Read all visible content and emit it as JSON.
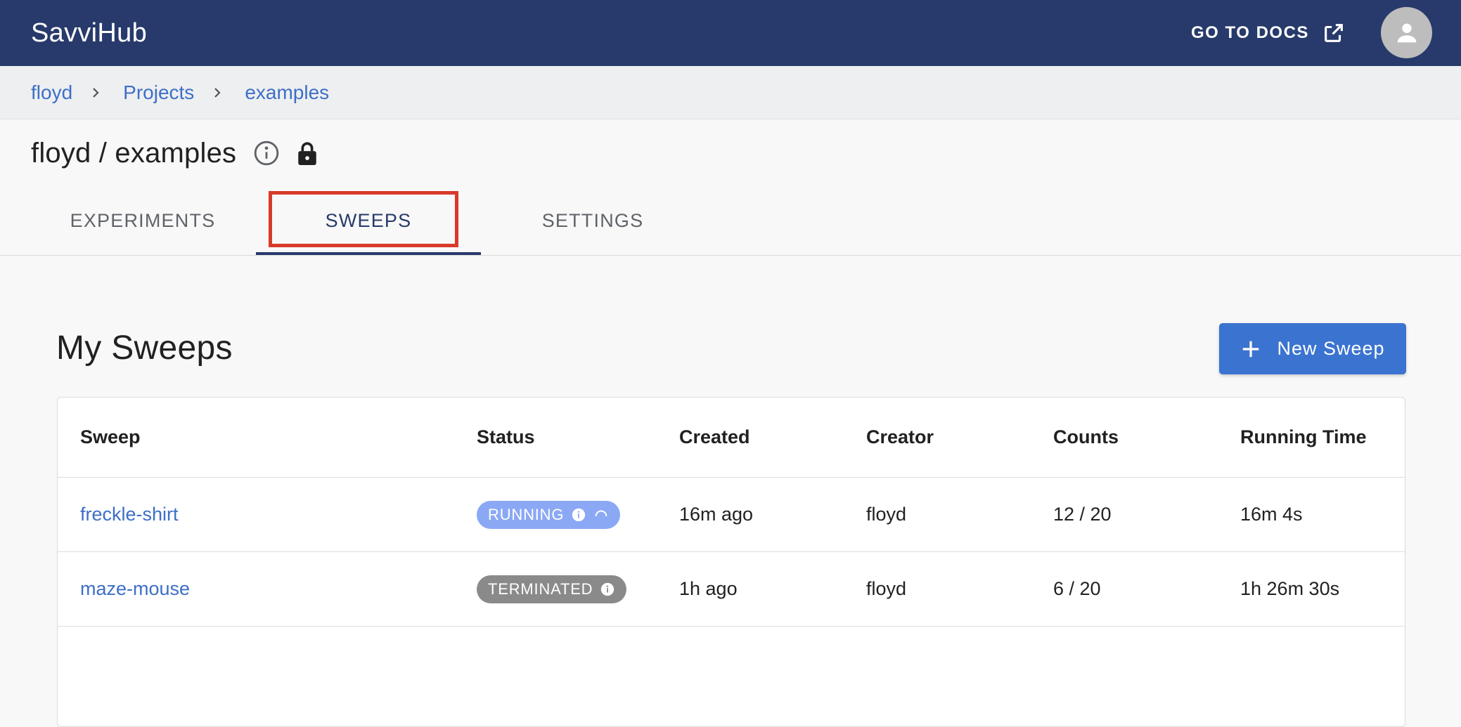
{
  "app": {
    "brand": "SavviHub",
    "docs_label": "GO TO DOCS"
  },
  "breadcrumb": [
    "floyd",
    "Projects",
    "examples"
  ],
  "page": {
    "title": "floyd / examples"
  },
  "tabs": [
    {
      "label": "EXPERIMENTS",
      "active": false
    },
    {
      "label": "SWEEPS",
      "active": true
    },
    {
      "label": "SETTINGS",
      "active": false
    }
  ],
  "sweeps": {
    "title": "My Sweeps",
    "new_button": "New Sweep",
    "columns": [
      "Sweep",
      "Status",
      "Created",
      "Creator",
      "Counts",
      "Running Time"
    ],
    "rows": [
      {
        "name": "freckle-shirt",
        "status": "RUNNING",
        "created": "16m ago",
        "creator": "floyd",
        "counts": "12 / 20",
        "running_time": "16m 4s"
      },
      {
        "name": "maze-mouse",
        "status": "TERMINATED",
        "created": "1h ago",
        "creator": "floyd",
        "counts": "6 / 20",
        "running_time": "1h 26m 30s"
      }
    ]
  },
  "colors": {
    "topbar": "#273a6b",
    "link": "#3d6fc7",
    "primary_button": "#3b73d0",
    "running_badge": "#8ba8f5",
    "terminated_badge": "#8a8a8a",
    "highlight": "#d93a2a"
  }
}
